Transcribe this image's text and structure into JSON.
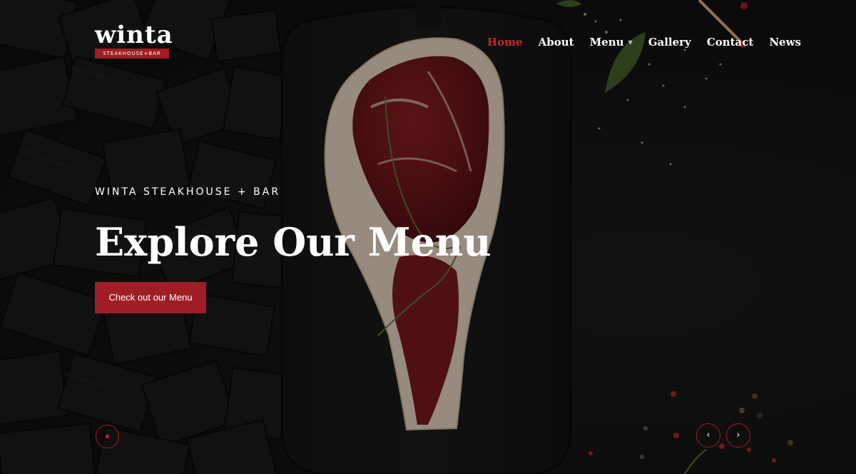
{
  "brand": {
    "name": "winta",
    "tagline": "STEAKHOUSE+BAR",
    "accent_color": "#a11d25"
  },
  "nav": {
    "items": [
      {
        "label": "Home",
        "active": true
      },
      {
        "label": "About",
        "active": false
      },
      {
        "label": "Menu",
        "active": false,
        "has_dropdown": true
      },
      {
        "label": "Gallery",
        "active": false
      },
      {
        "label": "Contact",
        "active": false
      },
      {
        "label": "News",
        "active": false
      }
    ],
    "dropdown_icon": "chevron-down-icon"
  },
  "hero": {
    "eyebrow": "WINTA STEAKHOUSE + BAR",
    "headline": "Explore Our Menu",
    "cta_label": "Check out our Menu",
    "background": "ribeye steak on dark cutting board with charcoal, salt and peppercorns"
  },
  "slider": {
    "prev_icon": "chevron-left-icon",
    "next_icon": "chevron-right-icon",
    "prev_glyph": "‹",
    "next_glyph": "›",
    "indicator_icon": "dot-indicator-icon"
  }
}
